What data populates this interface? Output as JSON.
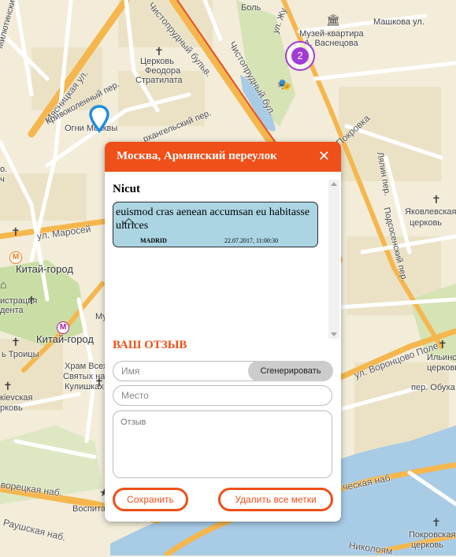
{
  "map": {
    "labels": [
      {
        "id": "bolsh",
        "text": "Боль"
      },
      {
        "id": "mashkova",
        "text": "Машкова ул."
      },
      {
        "id": "museum1",
        "text": "Музей-квартира"
      },
      {
        "id": "museum2",
        "text": "А. Васнецова"
      },
      {
        "id": "miluti",
        "text": "Милютинский пер."
      },
      {
        "id": "myasn",
        "text": "Мясницкая ул."
      },
      {
        "id": "chist1",
        "text": "Чистопрудный бульв."
      },
      {
        "id": "chist2",
        "text": "Чистопрудный бул."
      },
      {
        "id": "zhuk",
        "text": "ул. Жу"
      },
      {
        "id": "church1a",
        "text": "Церковь"
      },
      {
        "id": "church1b",
        "text": "Феодора"
      },
      {
        "id": "church1c",
        "text": "Стратилата"
      },
      {
        "id": "krivok",
        "text": "Кривоколенный пер."
      },
      {
        "id": "ogni",
        "text": "Огни Москвы"
      },
      {
        "id": "arkh",
        "text": "рхангельский пер."
      },
      {
        "id": "pokrovka",
        "text": "Покровка"
      },
      {
        "id": "lyalin",
        "text": "Лялин пер."
      },
      {
        "id": "yakov1",
        "text": "Яковлевская"
      },
      {
        "id": "yakov2",
        "text": "церковь"
      },
      {
        "id": "podsos",
        "text": "Подсосенский пер."
      },
      {
        "id": "maros",
        "text": "ул. Маросей"
      },
      {
        "id": "kitai1",
        "text": "Китай-город"
      },
      {
        "id": "admin1",
        "text": "истрация"
      },
      {
        "id": "admin2",
        "text": "дента"
      },
      {
        "id": "kitai2",
        "text": "Китай-город"
      },
      {
        "id": "troitsy",
        "text": "ь Троицы"
      },
      {
        "id": "hram1",
        "text": "Храм Всех"
      },
      {
        "id": "hram2",
        "text": "Святых на"
      },
      {
        "id": "hram3",
        "text": "Кулишках"
      },
      {
        "id": "kievsk1",
        "text": "кievская"
      },
      {
        "id": "kievsk2",
        "text": "рковь"
      },
      {
        "id": "vorontsovo",
        "text": "ул. Воронцово Поле"
      },
      {
        "id": "ilyin1",
        "text": "Ильинс"
      },
      {
        "id": "ilyin2",
        "text": "церковь"
      },
      {
        "id": "obukh",
        "text": "пер. Обуха"
      },
      {
        "id": "varvar",
        "text": "ворецкая наб."
      },
      {
        "id": "raush",
        "text": "Раушская наб."
      },
      {
        "id": "vospit",
        "text": "Воспитат"
      },
      {
        "id": "yauz",
        "text": "ческая наб."
      },
      {
        "id": "nikol",
        "text": "Николоям"
      },
      {
        "id": "pokr1",
        "text": "Покровская"
      },
      {
        "id": "pokr2",
        "text": "церковь"
      },
      {
        "id": "mu",
        "text": "Му"
      },
      {
        "id": "o",
        "text": "о."
      },
      {
        "id": "ch",
        "text": "ч"
      }
    ],
    "cluster_count": "2"
  },
  "dialog": {
    "title": "Москва, Армянский переулок",
    "close": "✕",
    "review": {
      "author": "Nicut",
      "text": "euismod cras aenean accumsan eu habitasse ultrices",
      "place": "MADRID",
      "date": "22.07.2017, 11:00:30"
    },
    "form_title": "ВАШ ОТЗЫВ",
    "name_placeholder": "Имя",
    "generate_label": "Сгенерировать",
    "place_placeholder": "Место",
    "review_placeholder": "Отзыв",
    "save_label": "Сохранить",
    "delete_label": "Удалить все метки"
  },
  "colors": {
    "accent": "#ef4f18",
    "bubble": "#abd5e3",
    "cluster": "#a23bd6",
    "pin": "#1e8ee0"
  }
}
